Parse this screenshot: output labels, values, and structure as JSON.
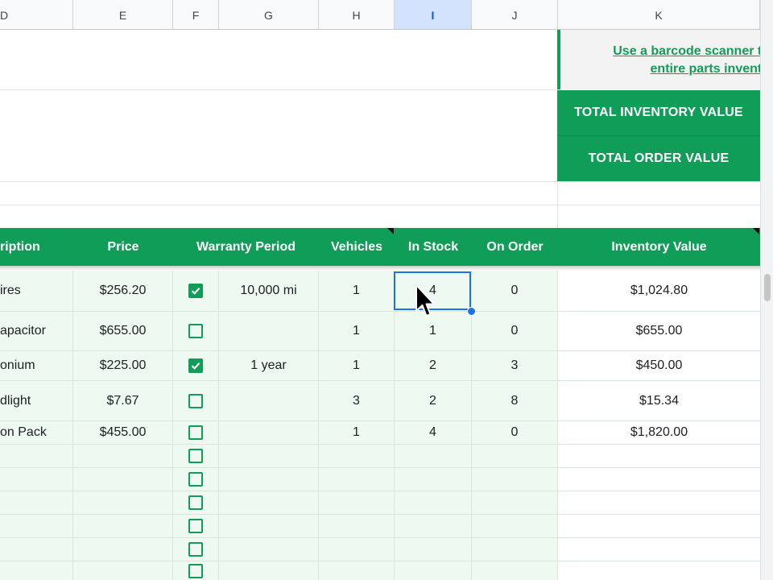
{
  "columns": [
    {
      "letter": "D",
      "active": false
    },
    {
      "letter": "E",
      "active": false
    },
    {
      "letter": "F",
      "active": false
    },
    {
      "letter": "G",
      "active": false
    },
    {
      "letter": "H",
      "active": false
    },
    {
      "letter": "I",
      "active": true
    },
    {
      "letter": "J",
      "active": false
    },
    {
      "letter": "K",
      "active": false
    }
  ],
  "summary": {
    "scanner_link_line1": "Use a barcode scanner to",
    "scanner_link_line2": "entire parts invento",
    "total_inventory_label": "TOTAL INVENTORY VALUE",
    "total_order_label": "TOTAL ORDER VALUE"
  },
  "headers": {
    "description": "ription",
    "price": "Price",
    "warranty": "Warranty Period",
    "vehicles": "Vehicles",
    "in_stock": "In Stock",
    "on_order": "On Order",
    "inventory_value": "Inventory Value"
  },
  "rows": [
    {
      "description": "ires",
      "price": "$256.20",
      "warranty_checked": true,
      "warranty": "10,000 mi",
      "vehicles": "1",
      "in_stock": "4",
      "on_order": "0",
      "inventory_value": "$1,024.80"
    },
    {
      "description": "apacitor",
      "price": "$655.00",
      "warranty_checked": false,
      "warranty": "",
      "vehicles": "1",
      "in_stock": "1",
      "on_order": "0",
      "inventory_value": "$655.00"
    },
    {
      "description": "onium",
      "price": "$225.00",
      "warranty_checked": true,
      "warranty": "1 year",
      "vehicles": "1",
      "in_stock": "2",
      "on_order": "3",
      "inventory_value": "$450.00"
    },
    {
      "description": "dlight",
      "price": "$7.67",
      "warranty_checked": false,
      "warranty": "",
      "vehicles": "3",
      "in_stock": "2",
      "on_order": "8",
      "inventory_value": "$15.34"
    },
    {
      "description": "on Pack",
      "price": "$455.00",
      "warranty_checked": false,
      "warranty": "",
      "vehicles": "1",
      "in_stock": "4",
      "on_order": "0",
      "inventory_value": "$1,820.00"
    }
  ],
  "empty_checkbox_rows": 6,
  "colors": {
    "brand_green": "#0f9d58",
    "light_green": "#eef9f1",
    "selection_blue": "#1a73e8"
  },
  "icons": {
    "checkbox_checked": "check-icon",
    "cursor": "mouse-pointer-icon"
  }
}
